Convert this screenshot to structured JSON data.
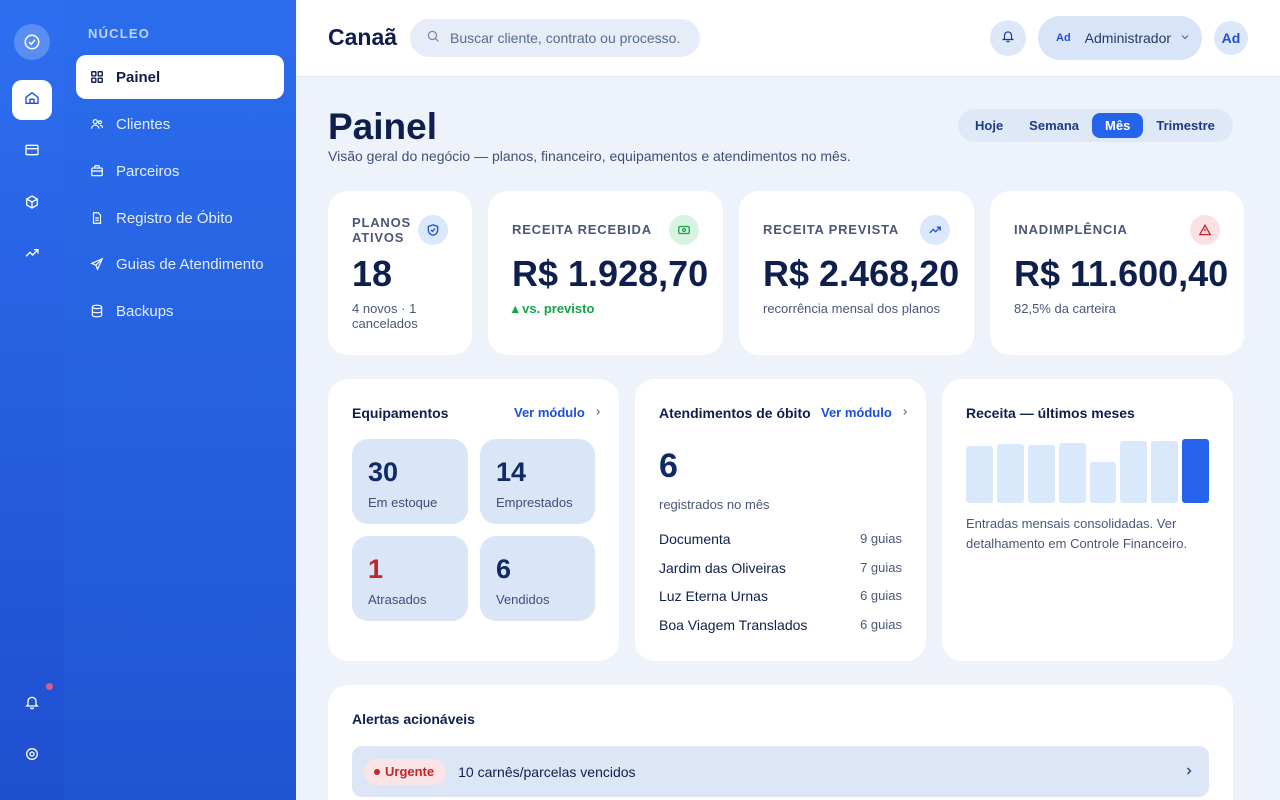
{
  "app": {
    "brand": "Canaã"
  },
  "rail": {
    "icons": [
      "check-circle-icon",
      "home-icon",
      "card-icon",
      "box-icon",
      "trending-up-icon",
      "bell-icon",
      "settings-icon"
    ]
  },
  "sidebar": {
    "section": "NÚCLEO",
    "items": [
      {
        "label": "Painel",
        "icon": "grid-icon",
        "active": true
      },
      {
        "label": "Clientes",
        "icon": "users-icon"
      },
      {
        "label": "Parceiros",
        "icon": "briefcase-icon"
      },
      {
        "label": "Registro de Óbito",
        "icon": "document-icon"
      },
      {
        "label": "Guias de Atendimento",
        "icon": "send-icon"
      },
      {
        "label": "Backups",
        "icon": "database-icon"
      }
    ]
  },
  "header": {
    "search_placeholder": "Buscar cliente, contrato ou processo.",
    "user_initials": "Ad",
    "user_name": "Administrador",
    "avatar_initials": "Ad"
  },
  "page": {
    "title": "Painel",
    "subtitle": "Visão geral do negócio — planos, financeiro, equipamentos e atendimentos no mês.",
    "ranges": [
      "Hoje",
      "Semana",
      "Mês",
      "Trimestre"
    ],
    "active_range": "Mês"
  },
  "kpis": [
    {
      "label": "PLANOS ATIVOS",
      "value": "18",
      "note": "4 novos · 1 cancelados",
      "icon": "shield-check-icon"
    },
    {
      "label": "RECEITA RECEBIDA",
      "value": "R$ 1.928,70",
      "note": "▴ vs. previsto",
      "icon": "cash-icon"
    },
    {
      "label": "RECEITA PREVISTA",
      "value": "R$ 2.468,20",
      "note": "recorrência mensal dos planos",
      "icon": "trending-up-icon"
    },
    {
      "label": "INADIMPLÊNCIA",
      "value": "R$ 11.600,40",
      "note": "82,5% da carteira",
      "icon": "warning-icon"
    }
  ],
  "colors": {
    "accent": "#2563eb",
    "danger": "#c0262d",
    "success": "#16a34a"
  },
  "equipamentos": {
    "title": "Equipamentos",
    "link": "Ver módulo",
    "tiles": [
      {
        "value": "30",
        "label": "Em estoque"
      },
      {
        "value": "14",
        "label": "Emprestados"
      },
      {
        "value": "1",
        "label": "Atrasados"
      },
      {
        "value": "6",
        "label": "Vendidos"
      }
    ]
  },
  "obitos": {
    "title": "Atendimentos de óbito",
    "link": "Ver módulo",
    "total": "6",
    "total_label": "registrados no mês",
    "rows": [
      {
        "name": "Documenta",
        "count": "9 guias"
      },
      {
        "name": "Jardim das Oliveiras",
        "count": "7 guias"
      },
      {
        "name": "Luz Eterna Urnas",
        "count": "6 guias"
      },
      {
        "name": "Boa Viagem Translados",
        "count": "6 guias"
      }
    ]
  },
  "receita": {
    "title": "Receita — últimos meses",
    "note": "Entradas mensais consolidadas. Ver detalhamento em Controle Financeiro."
  },
  "chart_data": {
    "type": "bar",
    "categories": [
      "",
      "",
      "",
      "",
      "",
      "",
      "",
      ""
    ],
    "values": [
      0.89,
      0.92,
      0.9,
      0.94,
      0.64,
      0.97,
      0.97,
      1.0
    ],
    "highlight_index": 7,
    "title": "Receita — últimos meses"
  },
  "alerts": {
    "title": "Alertas acionáveis",
    "items": [
      {
        "badge": "Urgente",
        "text": "10 carnês/parcelas vencidos"
      }
    ]
  }
}
